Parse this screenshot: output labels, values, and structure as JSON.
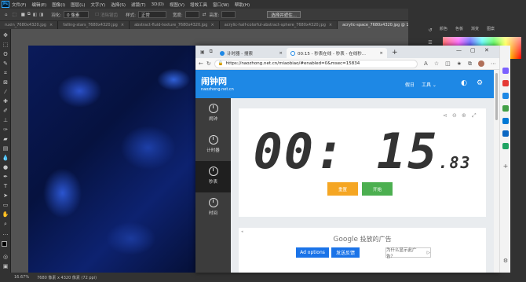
{
  "photoshop": {
    "menu": [
      "文件(F)",
      "编辑(E)",
      "图像(I)",
      "图层(L)",
      "文字(Y)",
      "选择(S)",
      "滤镜(T)",
      "3D(D)",
      "视图(V)",
      "增效工具",
      "窗口(W)",
      "帮助(H)"
    ],
    "options": {
      "feather_label": "羽化:",
      "feather_value": "0 像素",
      "antialias_label": "消除锯齿",
      "style_label": "样式:",
      "style_value": "正常",
      "width_label": "宽度:",
      "height_label": "高度:",
      "select_mask_button": "选择并遮住..."
    },
    "doc_tabs": [
      {
        "label": "ruxin_7680x4320.jpg",
        "active": false
      },
      {
        "label": "falling-stars_7680x4320.jpg",
        "active": false
      },
      {
        "label": "abstract-fluid-texture_7680x4320.jpg",
        "active": false
      },
      {
        "label": "acrylic-half-colorful-abstract-sphere_7680x4320.jpg",
        "active": false
      },
      {
        "label": "acrylic-space_7680x4320.jpg @ 16.7%(RGB/8#)",
        "active": true
      }
    ],
    "panel_tabs": [
      "颜色",
      "色板",
      "渐变",
      "图案"
    ],
    "status": {
      "zoom": "16.67%",
      "doc_size": "7680 像素 x 4320 像素 (72 ppi)"
    }
  },
  "browser": {
    "tabs": [
      {
        "label": "计时器 - 搜索",
        "active": false
      },
      {
        "label": "00:15 - 秒表在线 - 秒表 - 在线秒...",
        "active": true
      }
    ],
    "url": "https://naozhong.net.cn/miaobiao/#enabled=0&msec=15834"
  },
  "site": {
    "logo": "闹钟网",
    "subdomain": "naozhong.net.cn",
    "nav": [
      "假日",
      "工具 ⌄"
    ],
    "sidebar": [
      {
        "label": "闹钟",
        "active": false
      },
      {
        "label": "计时器",
        "active": false
      },
      {
        "label": "秒表",
        "active": true
      },
      {
        "label": "时间",
        "active": false
      }
    ],
    "timer": {
      "display": "00: 15",
      "ms": ".83"
    },
    "buttons": {
      "reset": "重置",
      "start": "开始"
    },
    "ad": {
      "title": "投放的广告",
      "brand": "Google",
      "options_btn": "Ad options",
      "feedback_btn": "发送反馈",
      "why_btn": "为什么显示此广告？"
    },
    "colors": {
      "header": "#1e88e5",
      "reset_btn": "#f5a623",
      "start_btn": "#4caf50",
      "ad_btn": "#1a73e8"
    }
  }
}
